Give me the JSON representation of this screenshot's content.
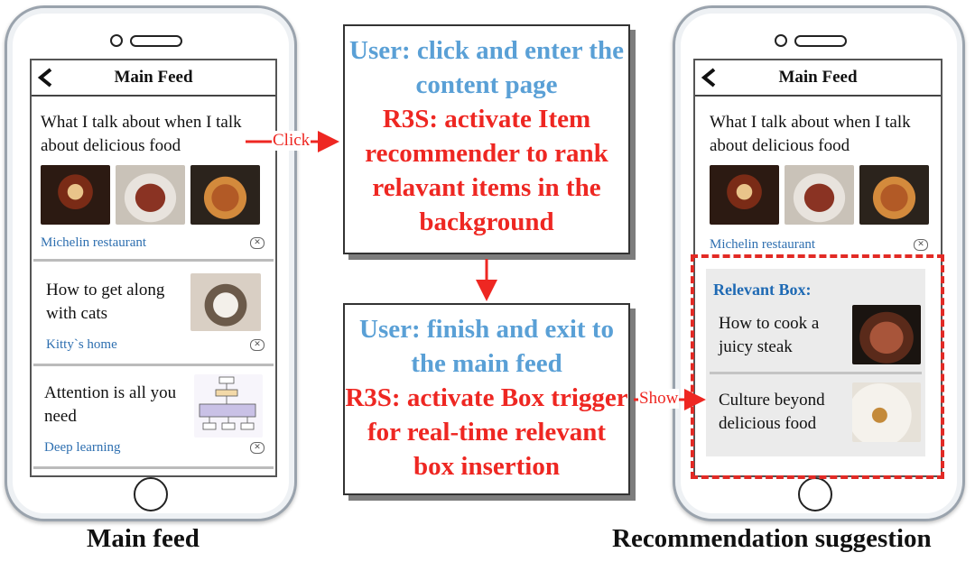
{
  "left_phone": {
    "topbar_title": "Main Feed",
    "post": {
      "title": "What I talk about when I talk about delicious food",
      "link": "Michelin restaurant"
    },
    "cards": [
      {
        "title": "How to get along with cats",
        "link": "Kitty`s home"
      },
      {
        "title": "Attention is all you need",
        "link": "Deep learning"
      }
    ]
  },
  "right_phone": {
    "topbar_title": "Main Feed",
    "post": {
      "title": "What I talk about when I talk about delicious food",
      "link": "Michelin restaurant"
    },
    "relevant_box": {
      "title": "Relevant Box:",
      "items": [
        {
          "title": "How to cook a juicy steak"
        },
        {
          "title": "Culture beyond delicious food"
        }
      ]
    }
  },
  "steps": {
    "top": {
      "user": "User: click and enter the content page",
      "system": "R3S: activate Item recommender to rank relavant items in the background"
    },
    "bottom": {
      "user": "User: finish and exit to the main feed",
      "system": "R3S: activate Box trigger for real-time relevant box insertion"
    }
  },
  "arrows": {
    "click": "Click",
    "show": "Show"
  },
  "captions": {
    "left": "Main feed",
    "right": "Recommendation suggestion"
  },
  "colors": {
    "user_text": "#5aa0d6",
    "system_text": "#ee2722",
    "link": "#2e6fb0",
    "relevant_title": "#1f6ab4"
  }
}
